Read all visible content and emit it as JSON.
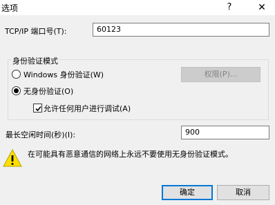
{
  "window": {
    "title": "选项",
    "help_label": "?",
    "close_label": "✕"
  },
  "port": {
    "label": "TCP/IP 端口号(T):",
    "value": "60123"
  },
  "auth": {
    "group_label": "身份验证模式",
    "windows_label": "Windows 身份验证(W)",
    "windows_checked": false,
    "permissions_label": "权限(P)...",
    "none_label": "无身份验证(O)",
    "none_checked": true,
    "allow_debug_label": "允许任何用户进行调试(A)",
    "allow_debug_checked": true
  },
  "idle": {
    "label": "最长空闲时间(秒)(I):",
    "value": "900"
  },
  "warning": {
    "icon": "warning-icon",
    "text": "在可能具有恶意通信的网络上永远不要使用无身份验证模式。"
  },
  "buttons": {
    "ok": "确定",
    "cancel": "取消"
  },
  "colors": {
    "accent": "#0078d7",
    "warning": "#fce100"
  }
}
